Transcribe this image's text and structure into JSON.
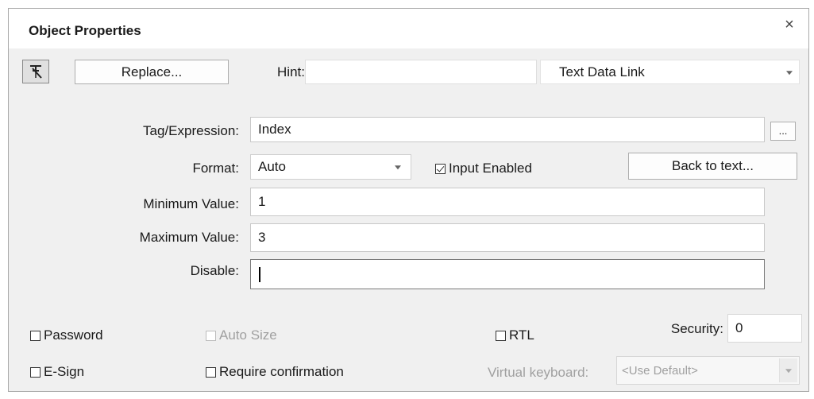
{
  "dialog": {
    "title": "Object Properties",
    "close_glyph": "×",
    "pin_icon": "pin-icon",
    "replace_label": "Replace...",
    "hint_label": "Hint:",
    "hint_value": "",
    "link_type": "Text Data Link",
    "tag_label": "Tag/Expression:",
    "tag_value": "Index",
    "browse_label": "...",
    "format_label": "Format:",
    "format_value": "Auto",
    "input_enabled_label": "Input Enabled",
    "input_enabled_checked": true,
    "back_to_text_label": "Back to text...",
    "min_label": "Minimum Value:",
    "min_value": "1",
    "max_label": "Maximum Value:",
    "max_value": "3",
    "disable_label": "Disable:",
    "disable_value": "",
    "password_label": "Password",
    "auto_size_label": "Auto Size",
    "rtl_label": "RTL",
    "security_label": "Security:",
    "security_value": "0",
    "esign_label": "E-Sign",
    "require_confirmation_label": "Require confirmation",
    "virtual_keyboard_label": "Virtual keyboard:",
    "virtual_keyboard_value": "<Use Default>"
  }
}
